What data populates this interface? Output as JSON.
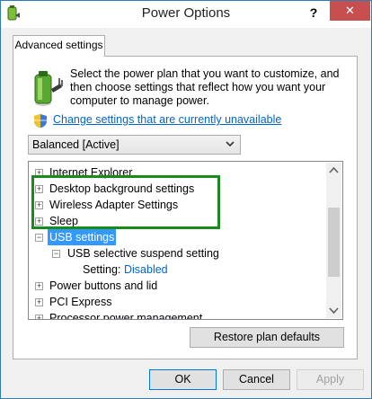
{
  "window": {
    "title": "Power Options",
    "help_label": "?",
    "close_label": "✕"
  },
  "tabs": [
    {
      "label": "Advanced settings",
      "active": true
    }
  ],
  "intro_text": "Select the power plan that you want to customize, and then choose settings that reflect how you want your computer to manage power.",
  "change_link": "Change settings that are currently unavailable",
  "plan_select": {
    "selected": "Balanced [Active]"
  },
  "tree": {
    "items": [
      {
        "label": "Internet Explorer",
        "expander": "+"
      },
      {
        "label": "Desktop background settings",
        "expander": "+"
      },
      {
        "label": "Wireless Adapter Settings",
        "expander": "+"
      },
      {
        "label": "Sleep",
        "expander": "+"
      },
      {
        "label": "USB settings",
        "expander": "−",
        "selected": true
      },
      {
        "label": "USB selective suspend setting",
        "expander": "−"
      },
      {
        "setting_label": "Setting:",
        "setting_value": "Disabled"
      },
      {
        "label": "Power buttons and lid",
        "expander": "+"
      },
      {
        "label": "PCI Express",
        "expander": "+"
      },
      {
        "label": "Processor power management",
        "expander": "+"
      }
    ]
  },
  "buttons": {
    "restore": "Restore plan defaults",
    "ok": "OK",
    "cancel": "Cancel",
    "apply": "Apply"
  },
  "colors": {
    "accent": "#3399ff",
    "link": "#0066cc",
    "close": "#c74f50",
    "highlight": "#1a8a1a"
  },
  "icons": {
    "app": "power-options-icon",
    "battery": "battery-plug-icon",
    "shield": "uac-shield-icon"
  }
}
